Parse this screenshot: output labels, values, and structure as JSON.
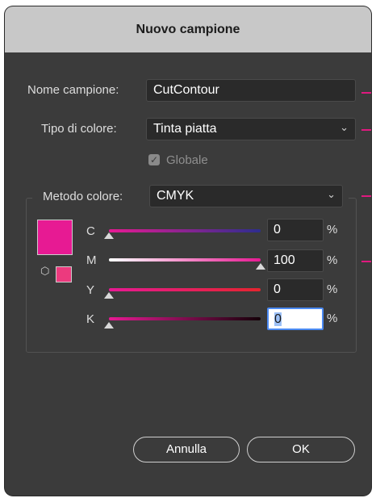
{
  "dialog": {
    "title": "Nuovo campione"
  },
  "fields": {
    "nome_label": "Nome campione:",
    "nome_value": "CutContour",
    "tipo_label": "Tipo di colore:",
    "tipo_value": "Tinta piatta",
    "globale_label": "Globale",
    "globale_checked": true,
    "metodo_label": "Metodo colore:",
    "metodo_value": "CMYK"
  },
  "swatch": {
    "color": "#e71a93",
    "gamut_color": "#ec3a7e",
    "gamut_icon": "cube-icon"
  },
  "channels": [
    {
      "label": "C",
      "value": "0",
      "unit": "%",
      "level": 0
    },
    {
      "label": "M",
      "value": "100",
      "unit": "%",
      "level": 1
    },
    {
      "label": "Y",
      "value": "0",
      "unit": "%",
      "level": 0
    },
    {
      "label": "K",
      "value": "0",
      "unit": "%",
      "level": 0
    }
  ],
  "buttons": {
    "cancel": "Annulla",
    "ok": "OK"
  },
  "icons": {
    "dropdown": "chevron-down-icon",
    "check": "checkmark-icon"
  },
  "colors": {
    "accent": "#e0197f",
    "focus": "#4b8af2"
  }
}
